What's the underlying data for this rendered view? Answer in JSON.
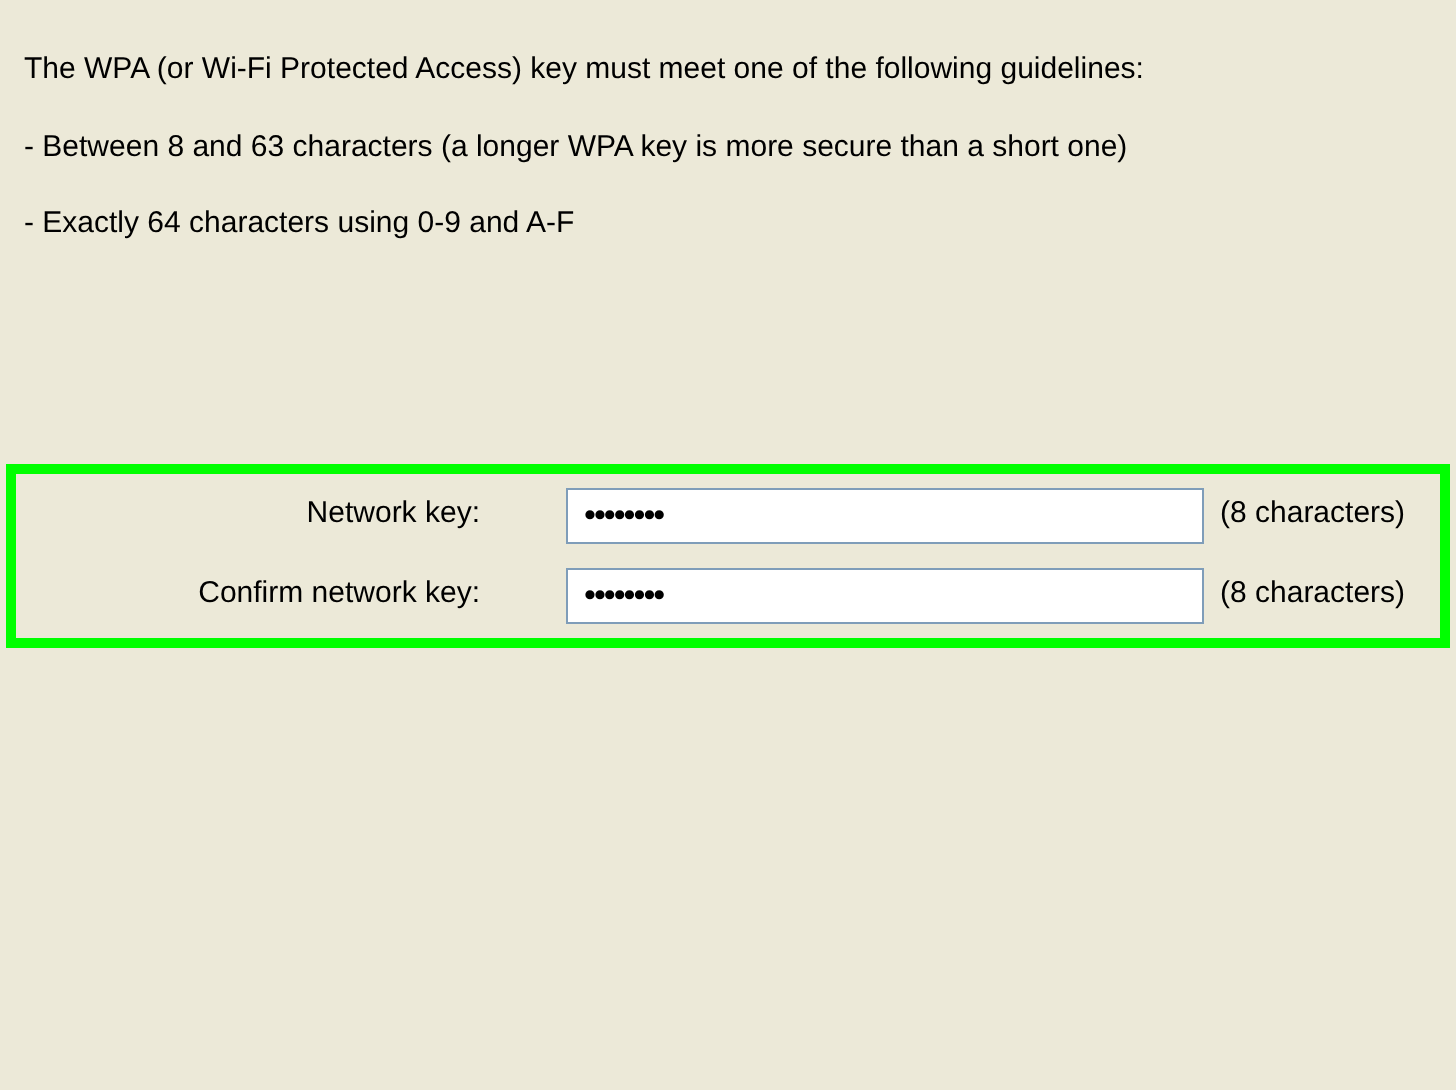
{
  "intro": "The WPA (or Wi-Fi Protected Access) key must meet one of the following guidelines:",
  "guidelines": [
    "- Between 8 and 63 characters (a longer WPA key is more secure than a short one)",
    "- Exactly 64 characters using 0-9 and A-F"
  ],
  "highlight": {
    "color": "#00ff00"
  },
  "fields": [
    {
      "label": "Network key:",
      "value": "••••••••",
      "hint": "(8 characters)"
    },
    {
      "label": "Confirm network key:",
      "value": "••••••••",
      "hint": "(8 characters)"
    }
  ]
}
